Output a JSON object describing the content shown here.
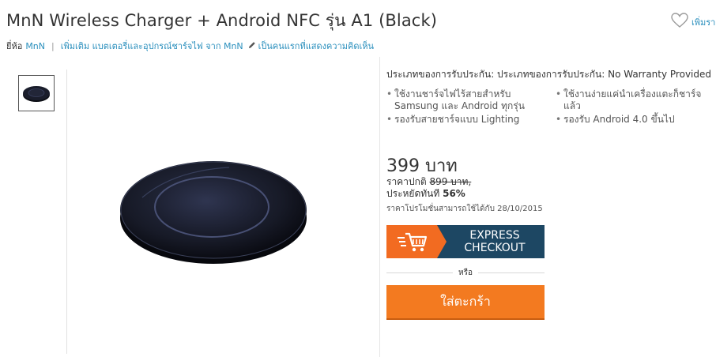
{
  "product": {
    "title": "MnN Wireless Charger + Android NFC รุ่น A1 (Black)",
    "wishlist_label": "เพิ่มรา",
    "brand_label": "ยี่ห้อ",
    "brand_name": "MnN",
    "more_link": "เพิ่มเติม แบตเตอรี่และอุปกรณ์ชาร์จไฟ จาก MnN",
    "review_link": "เป็นคนแรกที่แสดงความคิดเห็น"
  },
  "warranty": "ประเภทของการรับประกัน: ประเภทของการรับประกัน: No Warranty Provided",
  "features": [
    "ใช้งานชาร์จไฟไร้สายสำหรับ Samsung และ Android ทุกรุ่น",
    "ใช้งานง่ายแค่นำเครื่องแตะก็ชาร์จแล้ว",
    "รองรับสายชาร์จแบบ Lighting",
    "รองรับ Android 4.0 ขึ้นไป"
  ],
  "pricing": {
    "price": "399 บาท",
    "regular_label": "ราคาปกติ",
    "regular_price": "899 บาท,",
    "saving_label": "ประหยัดทันที",
    "saving_value": "56%",
    "promo_note": "ราคาโปรโมชั่นสามารถใช้ได้กับ 28/10/2015"
  },
  "actions": {
    "express_line1": "EXPRESS",
    "express_line2": "CHECKOUT",
    "or_label": "หรือ",
    "add_to_cart": "ใส่ตะกร้า"
  },
  "icons": {
    "wishlist": "heart-outline-icon",
    "review": "pencil-icon",
    "express": "shopping-cart-speed-icon"
  },
  "colors": {
    "link": "#2a8fbd",
    "express_bg": "#1d4763",
    "accent_orange": "#f37a20"
  }
}
